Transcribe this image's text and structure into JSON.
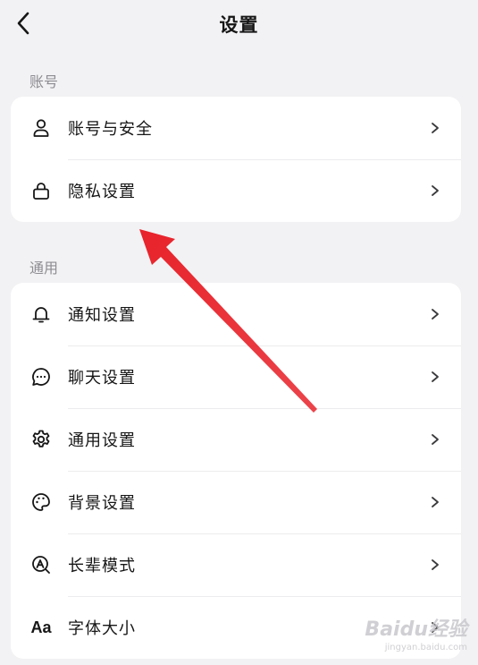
{
  "header": {
    "title": "设置"
  },
  "sections": [
    {
      "label": "账号",
      "items": [
        {
          "label": "账号与安全",
          "icon": "user-icon"
        },
        {
          "label": "隐私设置",
          "icon": "lock-icon"
        }
      ]
    },
    {
      "label": "通用",
      "items": [
        {
          "label": "通知设置",
          "icon": "bell-icon"
        },
        {
          "label": "聊天设置",
          "icon": "chat-bubble-icon"
        },
        {
          "label": "通用设置",
          "icon": "gear-icon"
        },
        {
          "label": "背景设置",
          "icon": "palette-icon"
        },
        {
          "label": "长辈模式",
          "icon": "elder-mode-icon"
        },
        {
          "label": "字体大小",
          "icon": "font-size-icon"
        }
      ]
    }
  ],
  "font_size_icon_text": "Aa",
  "watermark": {
    "main": "Baidu经验",
    "sub": "jingyan.baidu.com"
  },
  "colors": {
    "background": "#f2f2f4",
    "card": "#ffffff",
    "section_label": "#8d8d92",
    "annotation_arrow": "#e8232b"
  }
}
